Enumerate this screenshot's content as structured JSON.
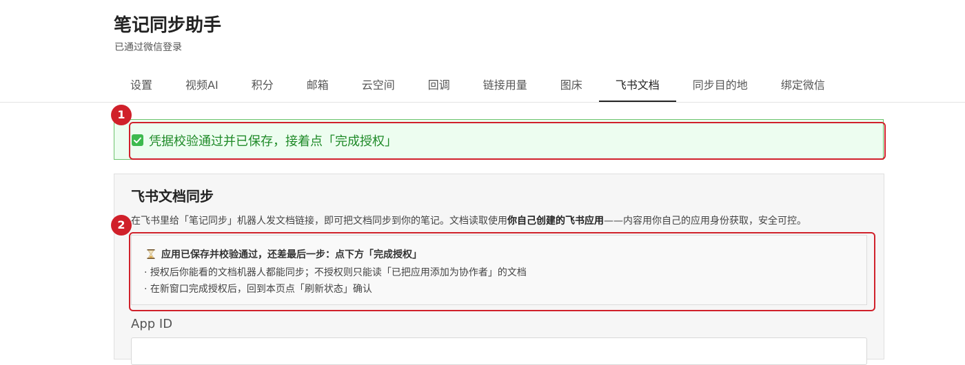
{
  "header": {
    "title": "笔记同步助手",
    "subtitle": "已通过微信登录"
  },
  "tabs": [
    {
      "label": "设置"
    },
    {
      "label": "视频AI"
    },
    {
      "label": "积分"
    },
    {
      "label": "邮箱"
    },
    {
      "label": "云空间"
    },
    {
      "label": "回调"
    },
    {
      "label": "链接用量"
    },
    {
      "label": "图床"
    },
    {
      "label": "飞书文档",
      "active": true
    },
    {
      "label": "同步目的地"
    },
    {
      "label": "绑定微信"
    }
  ],
  "success_banner": {
    "icon": "checkmark-icon",
    "text": "凭据校验通过并已保存，接着点「完成授权」"
  },
  "markers": [
    "1",
    "2"
  ],
  "section": {
    "title": "飞书文档同步",
    "desc_prefix": "在飞书里给「笔记同步」机器人发文档链接，即可把文档同步到你的笔记。文档读取使用",
    "desc_bold": "你自己创建的飞书应用",
    "desc_suffix": "——内容用你自己的应用身份获取，安全可控。"
  },
  "pending": {
    "icon": "hourglass-icon",
    "heading": "应用已保存并校验通过，还差最后一步：点下方「完成授权」",
    "items": [
      "· 授权后你能看的文档机器人都能同步；不授权则只能读「已把应用添加为协作者」的文档",
      "· 在新窗口完成授权后，回到本页点「刷新状态」确认"
    ]
  },
  "app_id": {
    "label": "App ID",
    "value": ""
  },
  "colors": {
    "accent_red": "#d0202a",
    "success_green": "#1f8a28",
    "success_bg": "#edfdf0"
  }
}
